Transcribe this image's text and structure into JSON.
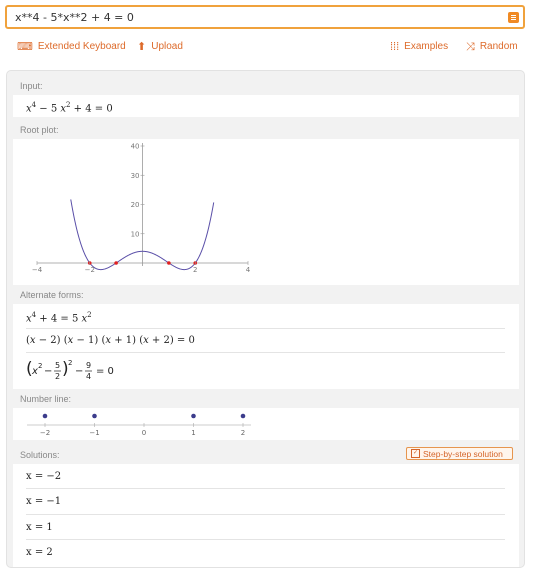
{
  "search": {
    "query": "x**4 - 5*x**2 + 4 = 0"
  },
  "toolbar": {
    "extended_keyboard": "Extended Keyboard",
    "upload": "Upload",
    "examples": "Examples",
    "random": "Random"
  },
  "pods": {
    "input_title": "Input:",
    "root_plot_title": "Root plot:",
    "alternate_forms_title": "Alternate forms:",
    "number_line_title": "Number line:",
    "solutions_title": "Solutions:",
    "step_by_step_label": "Step-by-step solution"
  },
  "solutions": [
    "x = −2",
    "x = −1",
    "x = 1",
    "x = 2"
  ],
  "number_line": {
    "points": [
      -2,
      -1,
      1,
      2
    ],
    "ticks": [
      "−2",
      "−1",
      "0",
      "1",
      "2"
    ]
  },
  "chart_data": {
    "type": "line",
    "function": "x^4 - 5x^2 + 4",
    "x_ticks": [
      "−4",
      "−2",
      "2",
      "4"
    ],
    "y_ticks": [
      "10",
      "20",
      "30",
      "40"
    ],
    "xlim": [
      -4,
      4
    ],
    "ylim": [
      -3,
      40
    ],
    "roots": [
      -2,
      -1,
      1,
      2
    ],
    "colors": {
      "curve": "#5a4fa8",
      "roots": "#e02020"
    }
  }
}
